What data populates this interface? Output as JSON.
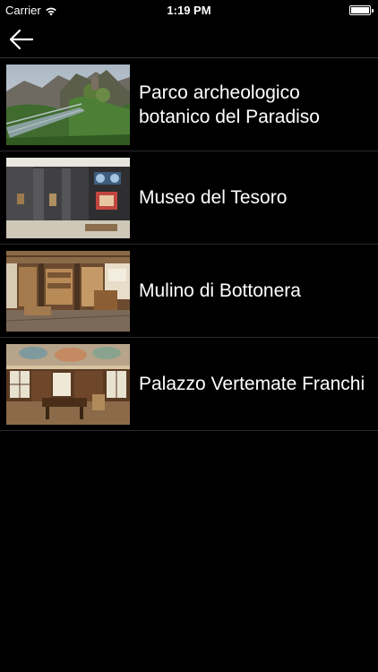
{
  "status_bar": {
    "carrier": "Carrier",
    "time": "1:19 PM",
    "wifi_icon": "wifi-icon",
    "battery_icon": "battery-full-icon"
  },
  "nav": {
    "back_icon": "arrow-left-icon"
  },
  "items": [
    {
      "title": "Parco archeologico botanico del Paradiso",
      "thumbnail": "mountain-walkway-photo"
    },
    {
      "title": "Museo del Tesoro",
      "thumbnail": "museum-display-room-photo"
    },
    {
      "title": "Mulino di Bottonera",
      "thumbnail": "wooden-mill-interior-photo"
    },
    {
      "title": "Palazzo Vertemate Franchi",
      "thumbnail": "frescoed-palace-room-photo"
    }
  ]
}
